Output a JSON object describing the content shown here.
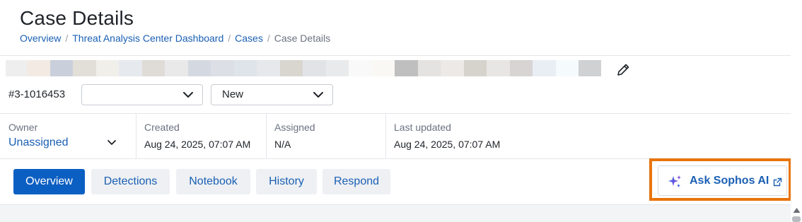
{
  "page": {
    "title": "Case Details"
  },
  "breadcrumb": {
    "items": [
      "Overview",
      "Threat Analysis Center Dashboard",
      "Cases"
    ],
    "current": "Case Details",
    "separator": "/"
  },
  "case": {
    "id": "#3-1016453",
    "name_redacted": true,
    "first_select_value": "",
    "status_select_value": "New"
  },
  "meta": {
    "owner_label": "Owner",
    "owner_value": "Unassigned",
    "created_label": "Created",
    "created_value": "Aug 24, 2025, 07:07 AM",
    "assigned_label": "Assigned",
    "assigned_value": "N/A",
    "updated_label": "Last updated",
    "updated_value": "Aug 24, 2025, 07:07 AM"
  },
  "tabs": [
    {
      "label": "Overview",
      "active": true
    },
    {
      "label": "Detections",
      "active": false
    },
    {
      "label": "Notebook",
      "active": false
    },
    {
      "label": "History",
      "active": false
    },
    {
      "label": "Respond",
      "active": false
    }
  ],
  "ask_ai": {
    "label": "Ask Sophos AI",
    "icon": "sparkle-icon",
    "external_icon": "external-link-icon",
    "highlight_color": "#e8740c"
  },
  "colors": {
    "accent": "#0c5fc2",
    "link": "#1a5fb4"
  }
}
